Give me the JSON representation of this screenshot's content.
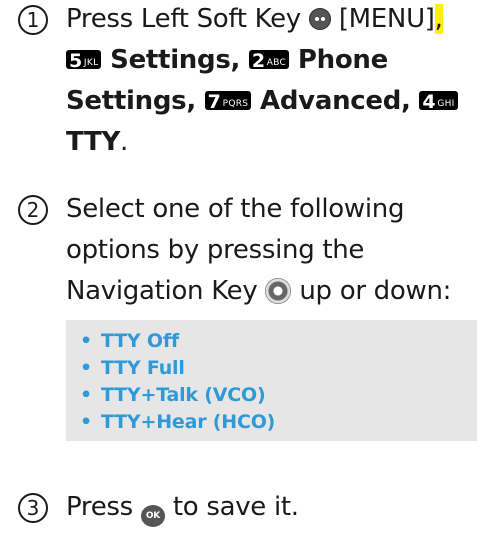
{
  "steps": [
    {
      "number": "1",
      "line1_prefix": "Press Left Soft Key",
      "line1_menu": "[MENU]",
      "line1_comma": ",",
      "keys": {
        "k5_digit": "5",
        "k5_letters": "JKL",
        "settings": "Settings,",
        "k2_digit": "2",
        "k2_letters": "ABC",
        "phone": "Phone",
        "phone_settings": "Settings,",
        "k7_digit": "7",
        "k7_letters": "PQRS",
        "advanced": "Advanced,",
        "k4_digit": "4",
        "k4_letters": "GHI",
        "tty": "TTY",
        "period": "."
      }
    },
    {
      "number": "2",
      "line1": "Select one of the following",
      "line2": "options by pressing the",
      "line3_prefix": "Navigation Key",
      "line3_suffix": "up or down:"
    },
    {
      "number": "3",
      "prefix": "Press",
      "ok_icon_label": "OK",
      "suffix": "to save it."
    }
  ],
  "options": [
    "TTY Off",
    "TTY Full",
    "TTY+Talk (VCO)",
    "TTY+Hear (HCO)"
  ],
  "colors": {
    "option_text": "#2e9ad6",
    "highlight": "#fff200",
    "option_bg": "#e6e6e6"
  },
  "icons": [
    "left-soft-key-icon",
    "navigation-key-icon",
    "ok-key-icon"
  ]
}
